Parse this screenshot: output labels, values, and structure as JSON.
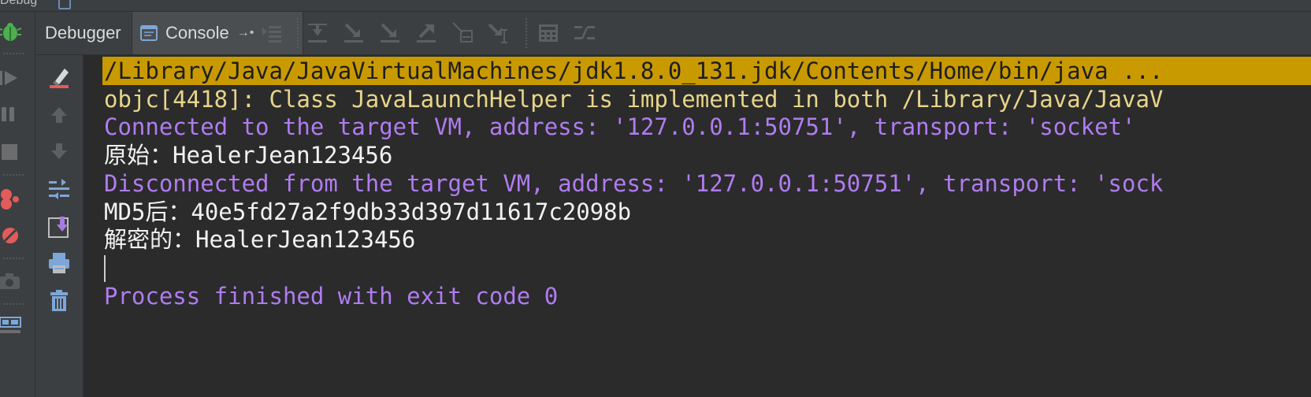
{
  "window": {
    "top_fragment": "Debug"
  },
  "tabs": {
    "debugger_label": "Debugger",
    "console_label": "Console",
    "pin_glyph": "→•"
  },
  "colors": {
    "console_bg": "#2b2b2b",
    "panel_bg": "#3c3f41",
    "highlight_bg": "#c99a00",
    "highlight_text": "#1e1e1e",
    "warning_text": "#e8d58a",
    "system_text": "#b07cf0",
    "stdout_text": "#f2f2f2"
  },
  "toolbar_icons": [
    "view-breakpoints-icon",
    "show-execution-point-icon",
    "step-over-icon",
    "step-into-icon",
    "force-step-into-icon",
    "step-out-icon",
    "drop-frame-icon",
    "run-to-cursor-icon",
    "evaluate-expression-icon",
    "trace-icon"
  ],
  "left_icons": [
    "debug-bug-icon",
    "resume-program-icon",
    "pause-program-icon",
    "stop-icon",
    "view-breakpoints-icon",
    "mute-breakpoints-icon",
    "get-thread-dump-icon",
    "restore-layout-icon"
  ],
  "side_icons": [
    "clear-all-icon",
    "up-arrow-icon",
    "down-arrow-icon",
    "soft-wrap-icon",
    "scroll-to-end-icon",
    "print-icon",
    "trash-icon"
  ],
  "console": {
    "lines": [
      {
        "text": "/Library/Java/JavaVirtualMachines/jdk1.8.0_131.jdk/Contents/Home/bin/java ...",
        "kind": "command"
      },
      {
        "text": "objc[4418]: Class JavaLaunchHelper is implemented in both /Library/Java/JavaV",
        "kind": "warning"
      },
      {
        "text": "Connected to the target VM, address: '127.0.0.1:50751', transport: 'socket'",
        "kind": "system"
      },
      {
        "text": "原始：HealerJean123456",
        "kind": "stdout"
      },
      {
        "text": "Disconnected from the target VM, address: '127.0.0.1:50751', transport: 'sock",
        "kind": "system"
      },
      {
        "text": "MD5后：40e5fd27a2f9db33d397d11617c2098b",
        "kind": "stdout"
      },
      {
        "text": "解密的：HealerJean123456",
        "kind": "stdout"
      },
      {
        "text": "",
        "kind": "stdout"
      },
      {
        "text": "Process finished with exit code 0",
        "kind": "system"
      }
    ]
  }
}
